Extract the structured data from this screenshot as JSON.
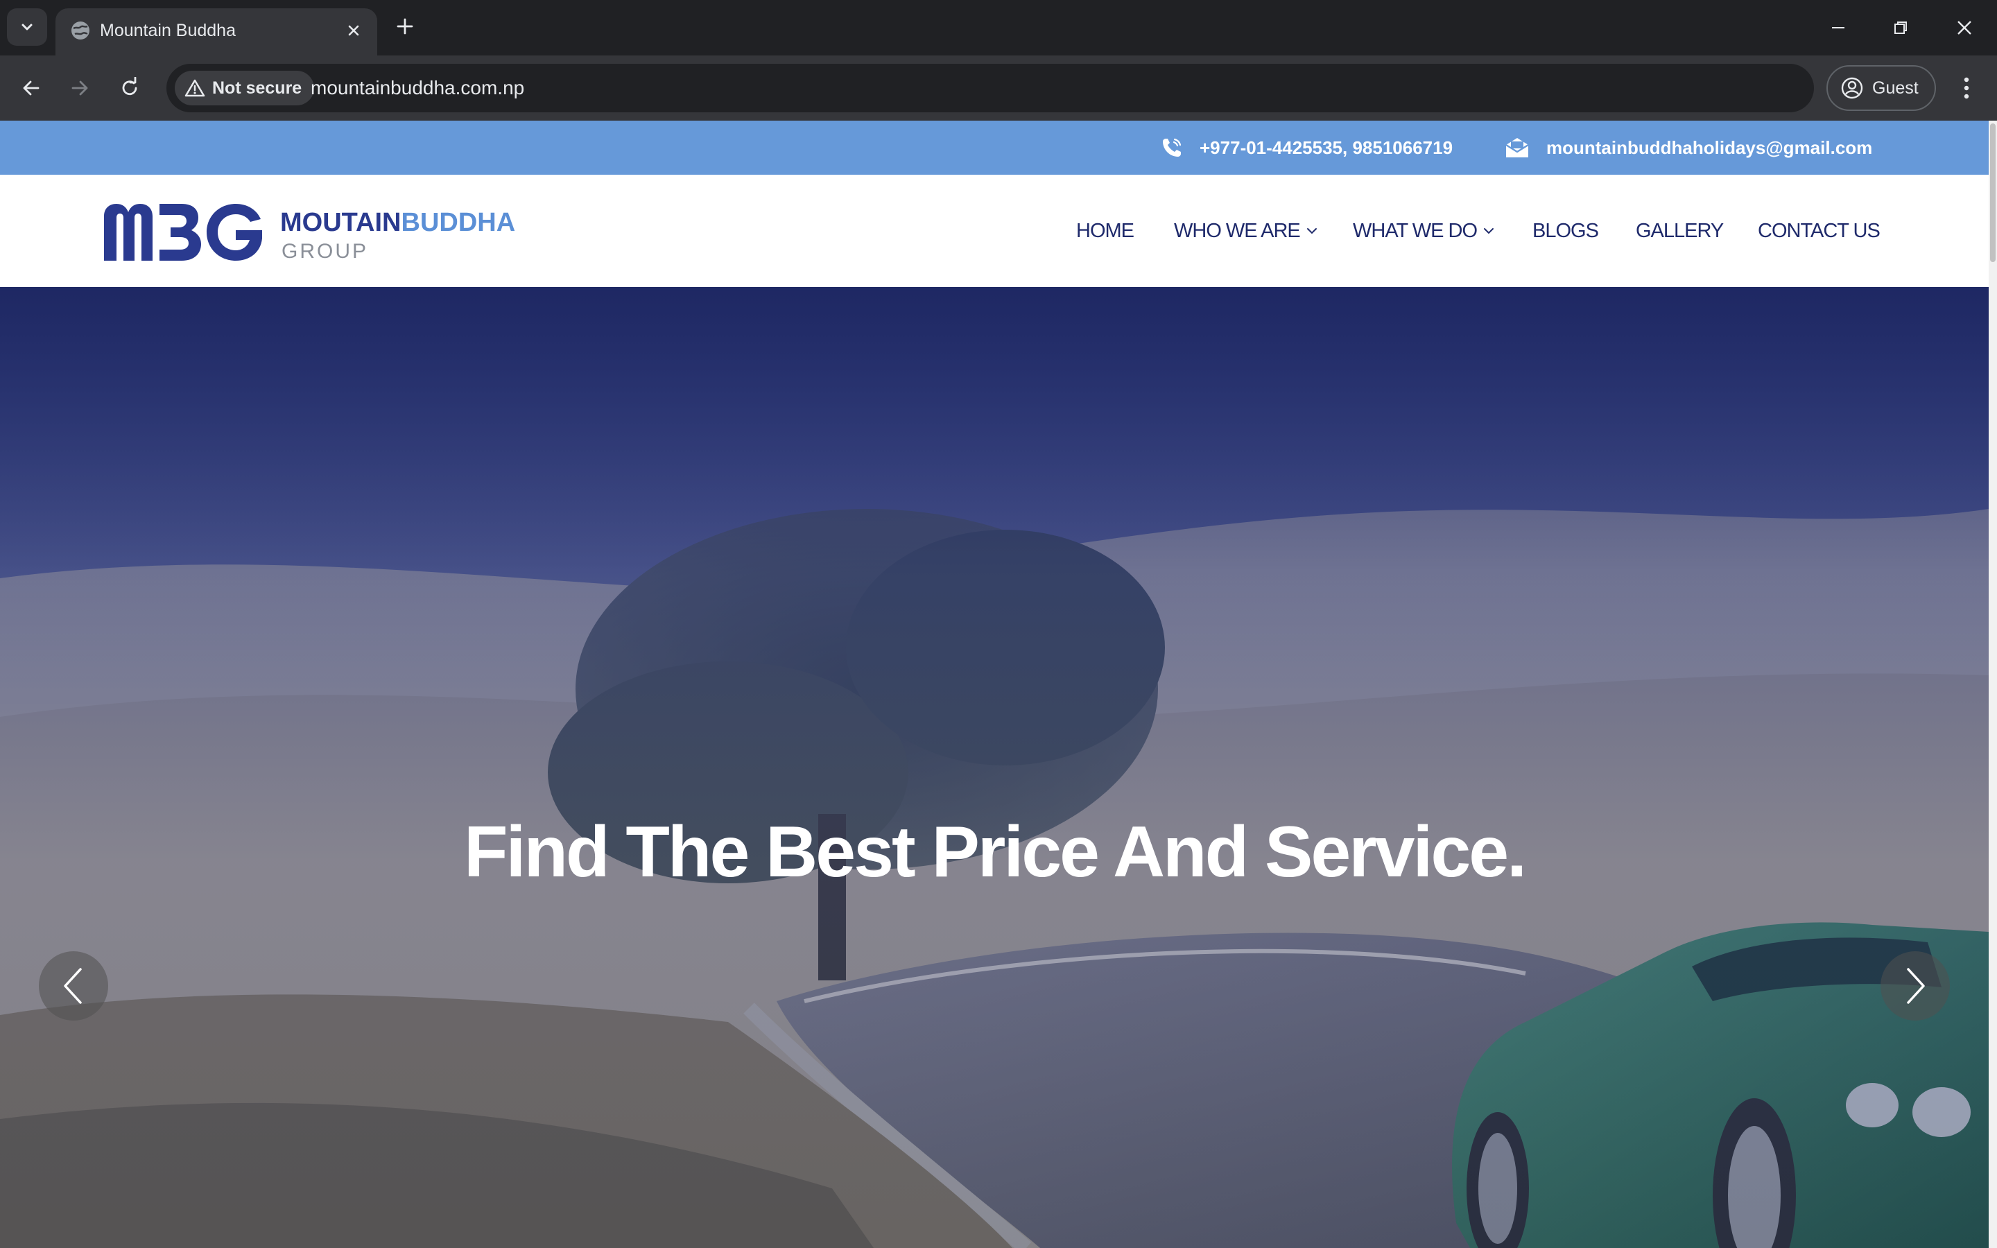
{
  "browser": {
    "tab_title": "Mountain Buddha",
    "security_label": "Not secure",
    "url": "mountainbuddha.com.np",
    "profile_label": "Guest"
  },
  "topbar": {
    "phone": "+977-01-4425535, 9851066719",
    "email": "mountainbuddhaholidays@gmail.com"
  },
  "logo": {
    "main_part1": "MOUTAIN",
    "main_part2": "BUDDHA",
    "sub": "GROUP",
    "colors": {
      "dark": "#2a3a8f",
      "light": "#5b8fd6",
      "grey": "#8a8f98"
    }
  },
  "nav": {
    "items": [
      {
        "label": "HOME",
        "has_dropdown": false
      },
      {
        "label": "WHO WE ARE",
        "has_dropdown": true
      },
      {
        "label": "WHAT WE DO",
        "has_dropdown": true
      },
      {
        "label": "BLOGS",
        "has_dropdown": false
      },
      {
        "label": "GALLERY",
        "has_dropdown": false
      },
      {
        "label": "CONTACT US",
        "has_dropdown": false
      }
    ]
  },
  "hero": {
    "heading": "Find The Best Price And Service."
  },
  "colors": {
    "topbar_bg": "#6699d9",
    "nav_text": "#1f2a6b",
    "chrome_bg": "#202124",
    "toolbar_bg": "#35363a"
  }
}
